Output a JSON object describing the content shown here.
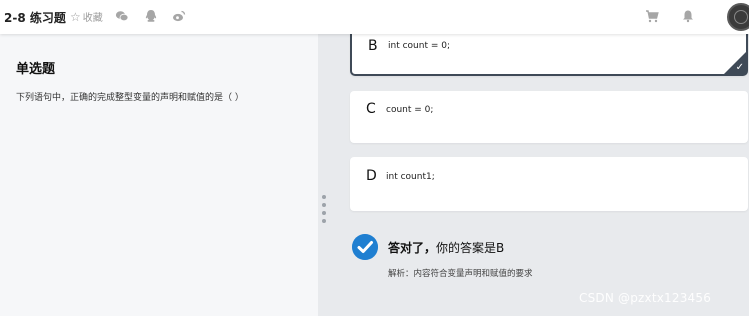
{
  "header": {
    "course_title": "2-8 练习题",
    "favorite_label": "收藏",
    "icons": [
      "star-icon",
      "wechat-icon",
      "qq-icon",
      "weibo-icon",
      "cart-icon",
      "bell-icon"
    ]
  },
  "question": {
    "type": "单选题",
    "text": "下列语句中，正确的完成整型变量的声明和赋值的是（ ）"
  },
  "options": [
    {
      "letter": "B",
      "text": "int count = 0;",
      "selected": true
    },
    {
      "letter": "C",
      "text": "count = 0;",
      "selected": false
    },
    {
      "letter": "D",
      "text": "int count1;",
      "selected": false
    }
  ],
  "result": {
    "status": "答对了，",
    "answer_text": "你的答案是B",
    "explanation": "解析：内容符合变量声明和赋值的要求"
  },
  "watermark": "CSDN @pzxtx123456",
  "colors": {
    "accent": "#1f7fd1",
    "selected_border": "#3f4a57"
  }
}
